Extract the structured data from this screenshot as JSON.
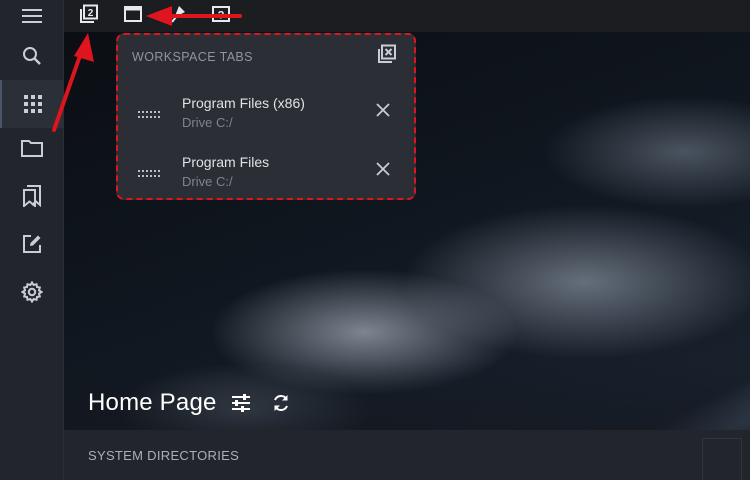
{
  "sidebar": {
    "items": [
      {
        "icon": "menu-icon"
      },
      {
        "icon": "search-icon"
      },
      {
        "icon": "apps-grid-icon",
        "active": true
      },
      {
        "icon": "folder-icon"
      },
      {
        "icon": "bookmarks-icon"
      },
      {
        "icon": "edit-icon"
      },
      {
        "icon": "settings-icon"
      }
    ]
  },
  "topbar": {
    "icons": [
      "workspace-tabs-icon",
      "window-icon",
      "pin-icon",
      "help-icon"
    ],
    "workspace_badge": "2",
    "help_badge": "?"
  },
  "workspace_popup": {
    "title": "WORKSPACE TABS",
    "tabs": [
      {
        "name": "Program Files (x86)",
        "drive": "Drive C:/"
      },
      {
        "name": "Program Files",
        "drive": "Drive C:/"
      }
    ]
  },
  "hero": {
    "title": "Home Page"
  },
  "section": {
    "label": "SYSTEM DIRECTORIES"
  },
  "colors": {
    "annotation": "#e0141c",
    "sidebar_bg": "#22252b",
    "popup_bg": "#2b2e34"
  }
}
